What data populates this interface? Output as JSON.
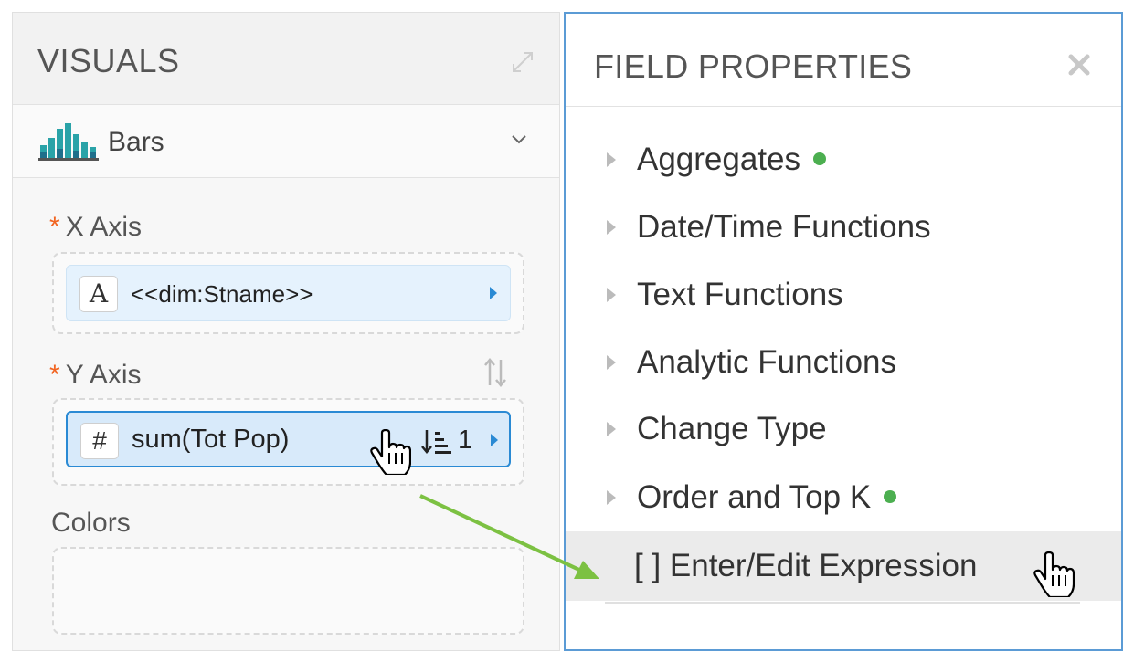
{
  "visuals": {
    "title": "VISUALS",
    "chart_type": "Bars",
    "x_axis": {
      "required_marker": "*",
      "label": "X Axis",
      "field_type": "A",
      "field_value": "<<dim:Stname>>"
    },
    "y_axis": {
      "required_marker": "*",
      "label": "Y Axis",
      "field_type": "#",
      "field_value": "sum(Tot Pop)",
      "sort_order": "1"
    },
    "colors": {
      "label": "Colors"
    }
  },
  "field_properties": {
    "title": "FIELD PROPERTIES",
    "items": [
      {
        "label": "Aggregates",
        "active": true
      },
      {
        "label": "Date/Time Functions",
        "active": false
      },
      {
        "label": "Text Functions",
        "active": false
      },
      {
        "label": "Analytic Functions",
        "active": false
      },
      {
        "label": "Change Type",
        "active": false
      },
      {
        "label": "Order and Top K",
        "active": true
      }
    ],
    "expression_item": "[ ] Enter/Edit Expression"
  },
  "colors": {
    "accent_blue": "#2a8ad4",
    "panel_border": "#5b9bd5",
    "required": "#f26522",
    "active_dot": "#4caf50",
    "annotation_arrow": "#7cc142"
  },
  "icons": [
    "expand-icon",
    "bars-chart-icon",
    "chevron-down-icon",
    "text-type-icon",
    "number-type-icon",
    "sort-desc-icon",
    "swap-icon",
    "hand-cursor-icon",
    "close-icon",
    "caret-right-icon"
  ]
}
